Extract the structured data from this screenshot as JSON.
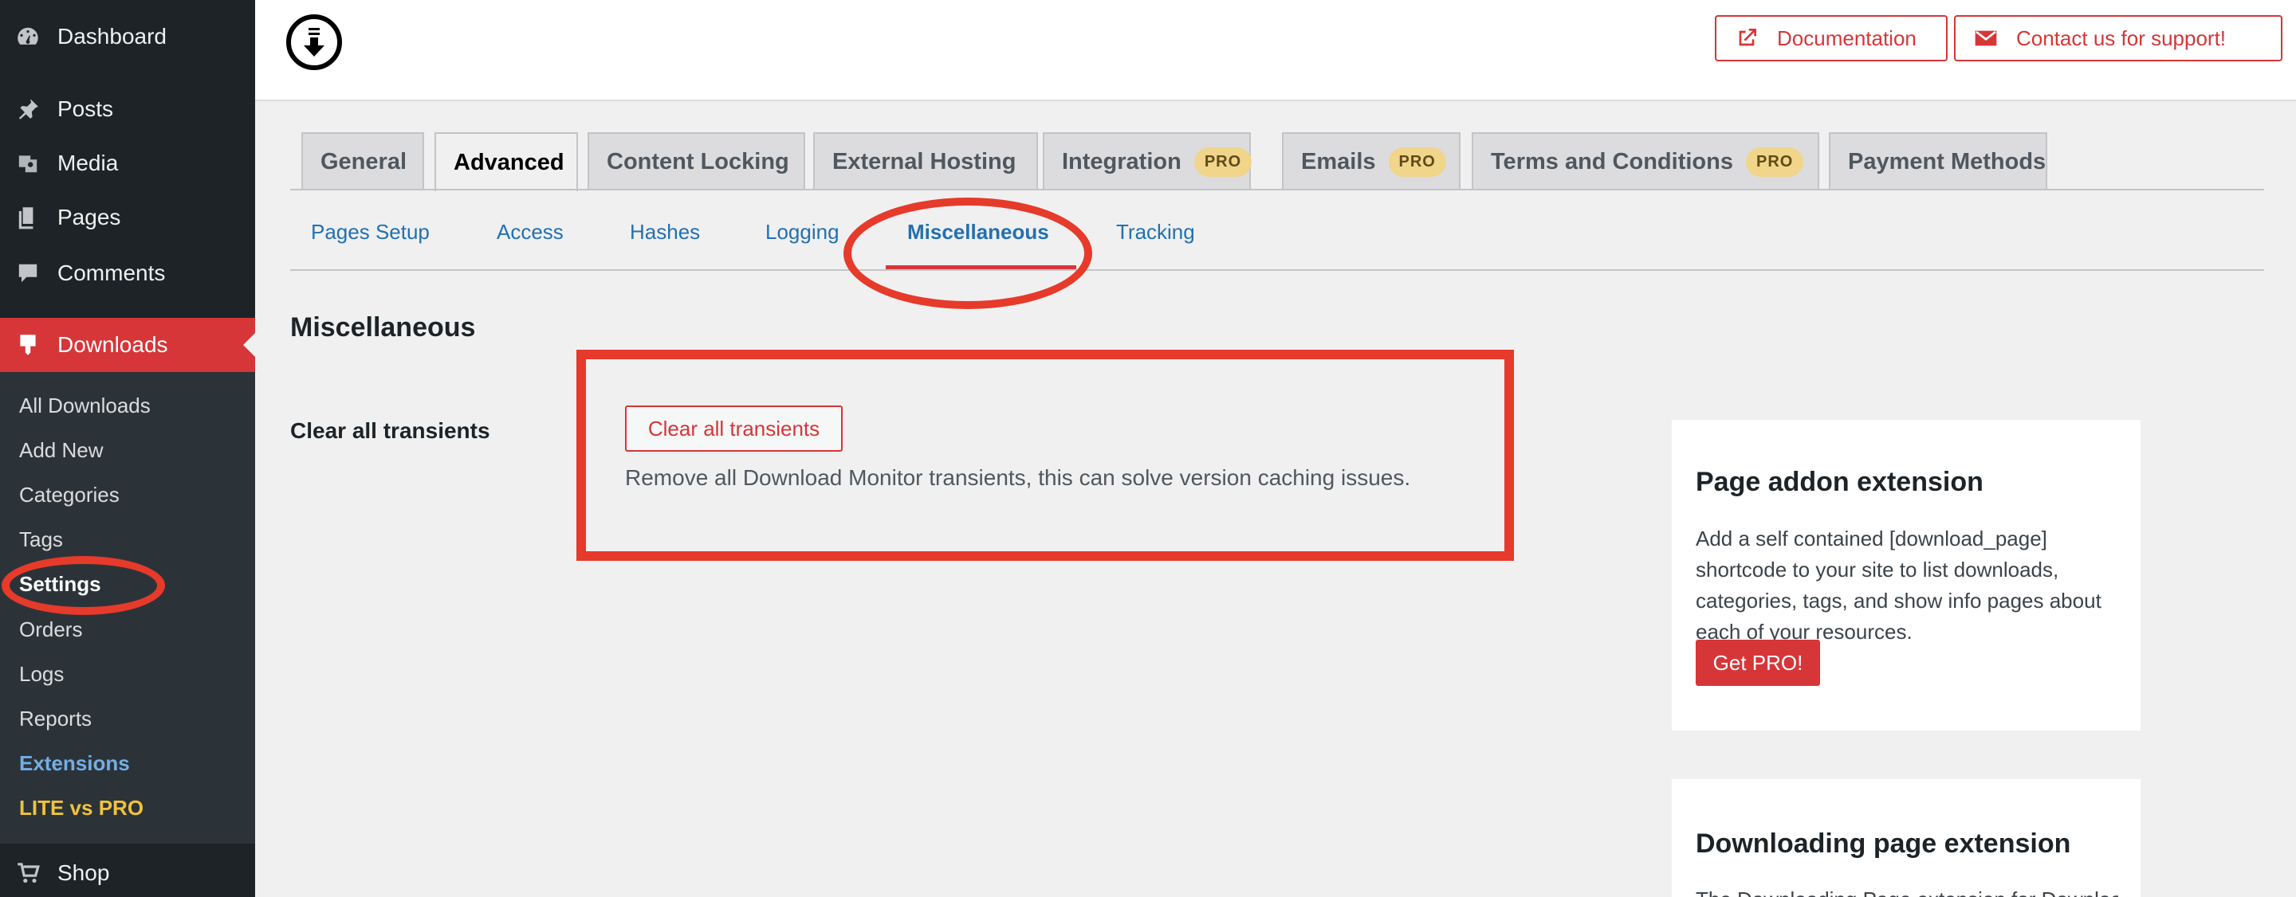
{
  "sidebar": {
    "top_items": [
      {
        "label": "Dashboard",
        "icon": "dashboard-icon"
      },
      {
        "label": "Posts",
        "icon": "pin-icon"
      },
      {
        "label": "Media",
        "icon": "media-icon"
      },
      {
        "label": "Pages",
        "icon": "pages-icon"
      },
      {
        "label": "Comments",
        "icon": "comment-icon"
      }
    ],
    "downloads": {
      "label": "Downloads",
      "icon": "download-icon"
    },
    "submenu": [
      {
        "label": "All Downloads"
      },
      {
        "label": "Add New"
      },
      {
        "label": "Categories"
      },
      {
        "label": "Tags"
      },
      {
        "label": "Settings"
      },
      {
        "label": "Orders"
      },
      {
        "label": "Logs"
      },
      {
        "label": "Reports"
      },
      {
        "label": "Extensions"
      },
      {
        "label": "LITE vs PRO"
      }
    ],
    "shop": {
      "label": "Shop",
      "icon": "cart-icon"
    }
  },
  "header": {
    "documentation_label": "Documentation",
    "support_label": "Contact us for support!"
  },
  "tabs": [
    {
      "label": "General"
    },
    {
      "label": "Advanced",
      "active": true
    },
    {
      "label": "Content Locking"
    },
    {
      "label": "External Hosting"
    },
    {
      "label": "Integration",
      "badge": "PRO"
    },
    {
      "label": "Emails",
      "badge": "PRO"
    },
    {
      "label": "Terms and Conditions",
      "badge": "PRO"
    },
    {
      "label": "Payment Methods"
    }
  ],
  "subtabs": [
    {
      "label": "Pages Setup"
    },
    {
      "label": "Access"
    },
    {
      "label": "Hashes"
    },
    {
      "label": "Logging"
    },
    {
      "label": "Miscellaneous",
      "active": true
    },
    {
      "label": "Tracking"
    }
  ],
  "section": {
    "title": "Miscellaneous",
    "row_label": "Clear all transients",
    "button_label": "Clear all transients",
    "description": "Remove all Download Monitor transients, this can solve version caching issues."
  },
  "cards": [
    {
      "title": "Page addon extension",
      "text": "Add a self contained [download_page] shortcode to your site to list downloads, categories, tags, and show info pages about each of your resources.",
      "button": "Get PRO!"
    },
    {
      "title": "Downloading page extension",
      "text": "The Downloading Page extension for Download Monitor"
    }
  ],
  "colors": {
    "accent": "#d63638",
    "annotation": "#e63a2b",
    "link": "#2271b1",
    "sidebar_bg": "#1d2327",
    "pro_badge": "#f0d58a"
  }
}
